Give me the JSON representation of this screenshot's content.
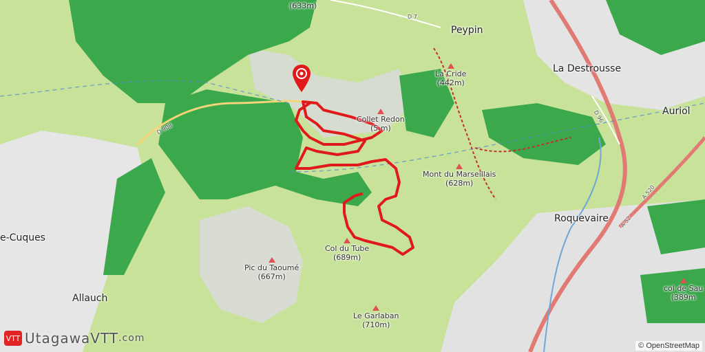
{
  "map": {
    "route_color": "#e01a1a",
    "forest_color": "#3aa84b",
    "grass_color": "#c8e29a",
    "urban_color": "#e6e6e6",
    "motorway_color": "#e07a73"
  },
  "towns": [
    {
      "id": "peypin",
      "name": "Peypin"
    },
    {
      "id": "la-destrousse",
      "name": "La Destrousse"
    },
    {
      "id": "auriol",
      "name": "Auriol"
    },
    {
      "id": "roquevaire",
      "name": "Roquevaire"
    },
    {
      "id": "allauch",
      "name": "Allauch"
    },
    {
      "id": "cuques",
      "name": "e-Cuques"
    }
  ],
  "peaks": [
    {
      "id": "top-peak",
      "name": "",
      "elev": "(633m)"
    },
    {
      "id": "la-cride",
      "name": "La Cride",
      "elev": "(442m)"
    },
    {
      "id": "collet-redon",
      "name": "Collet Redon",
      "elev": "(5 m)"
    },
    {
      "id": "mont-du-marseillais",
      "name": "Mont du Marseillais",
      "elev": "(628m)"
    },
    {
      "id": "col-du-tube",
      "name": "Col du Tube",
      "elev": "(689m)"
    },
    {
      "id": "pic-du-taoume",
      "name": "Pic du Taoumé",
      "elev": "(667m)"
    },
    {
      "id": "le-garlaban",
      "name": "Le Garlaban",
      "elev": "(710m)"
    },
    {
      "id": "col-de-sau",
      "name": "col de Sau",
      "elev": "(389m"
    }
  ],
  "roads": [
    "D 908",
    "D 7",
    "D 96",
    "A 52",
    "A 520"
  ],
  "branding": {
    "name": "UtagawaVTT",
    "domain": ".com",
    "badge": "VTT"
  },
  "attribution": "© OpenStreetMap"
}
